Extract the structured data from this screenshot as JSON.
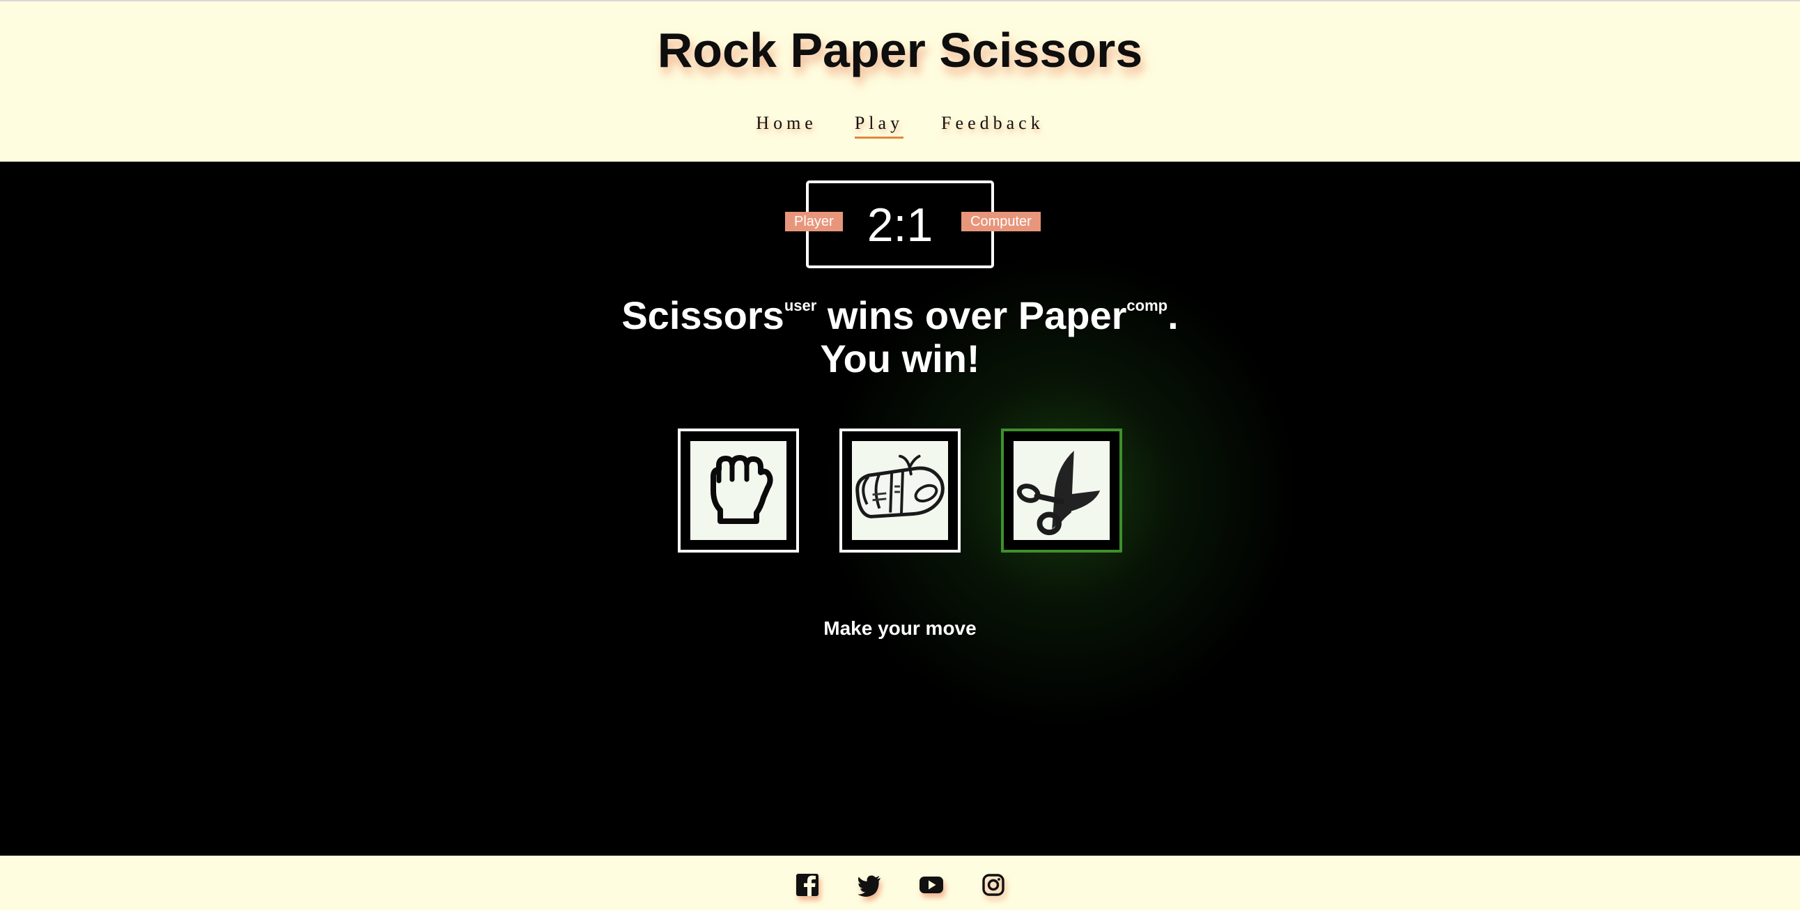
{
  "header": {
    "title": "Rock Paper Scissors",
    "nav": [
      {
        "label": "Home",
        "active": false
      },
      {
        "label": "Play",
        "active": true
      },
      {
        "label": "Feedback",
        "active": false
      }
    ]
  },
  "scoreboard": {
    "score": "2:1",
    "player_label": "Player",
    "computer_label": "Computer"
  },
  "result": {
    "user_choice": "Scissors",
    "user_tag": "user",
    "verb": "wins over",
    "computer_choice": "Paper",
    "computer_tag": "comp",
    "punctuation": ".",
    "outcome": "You win!"
  },
  "choices": [
    {
      "name": "rock",
      "icon": "fist-icon",
      "selected": false
    },
    {
      "name": "paper",
      "icon": "newspaper-icon",
      "selected": false
    },
    {
      "name": "scissors",
      "icon": "scissors-icon",
      "selected": true
    }
  ],
  "prompt": "Make your move",
  "footer": {
    "social": [
      "facebook-icon",
      "twitter-icon",
      "youtube-icon",
      "instagram-icon"
    ]
  },
  "colors": {
    "background_light": "#fffddf",
    "background_dark": "#000000",
    "accent": "#e8967b",
    "nav_underline": "#e08a3c",
    "win_border": "#3f8f2c"
  }
}
